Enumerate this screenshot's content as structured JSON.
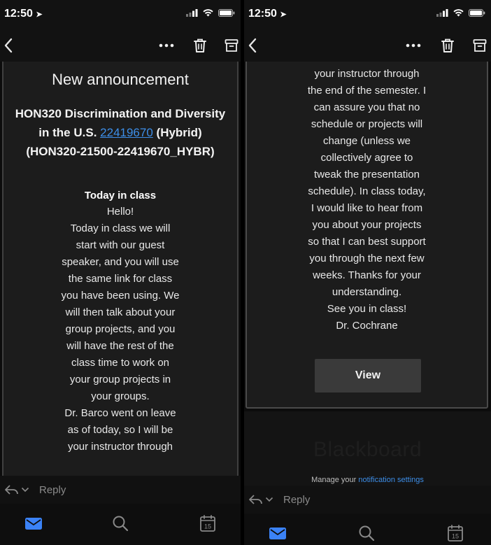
{
  "status": {
    "time": "12:50"
  },
  "left_screen": {
    "announcement_title": "New announcement",
    "course_title_prefix": "HON320 Discrimination and Diversity in the U.S.",
    "course_link": "22419670",
    "course_title_suffix": "(Hybrid) (HON320-21500-22419670_HYBR)",
    "message_heading": "Today in class",
    "message_lines": [
      "Hello!",
      "Today in class we will",
      "start with our guest",
      "speaker, and you will use",
      "the same link for class",
      "you have been using. We",
      "will then talk about your",
      "group projects, and you",
      "will have the rest of the",
      "class time to work on",
      "your group projects in",
      "your groups.",
      "Dr. Barco went on leave",
      "as of today, so I will be",
      "your instructor through"
    ],
    "reply_placeholder": "Reply"
  },
  "right_screen": {
    "message_lines": [
      "your instructor through",
      "the end of the semester. I",
      "can assure you that no",
      "schedule or projects will",
      "change (unless we",
      "collectively agree to",
      "tweak the presentation",
      "schedule). In class today,",
      "I would like to hear from",
      "you about your projects",
      "so that I can best support",
      "you through the next few",
      "weeks. Thanks for your",
      "understanding.",
      "See you in class!",
      "Dr. Cochrane"
    ],
    "view_button": "View",
    "blackboard_logo": "Blackboard",
    "manage_prefix": "Manage your",
    "manage_link": "notification settings",
    "reply_placeholder": "Reply"
  },
  "icons": {
    "back": "chevron-left-icon",
    "more": "more-dots-icon",
    "trash": "trash-icon",
    "archive": "archive-icon",
    "reply": "reply-icon",
    "mail": "mail-icon",
    "search": "search-icon",
    "calendar": "calendar-icon"
  },
  "calendar_day": "15",
  "colors": {
    "link": "#3d8ee8",
    "accent": "#3b82f6",
    "background": "#0c0c0c",
    "card": "#1c1c1c"
  }
}
